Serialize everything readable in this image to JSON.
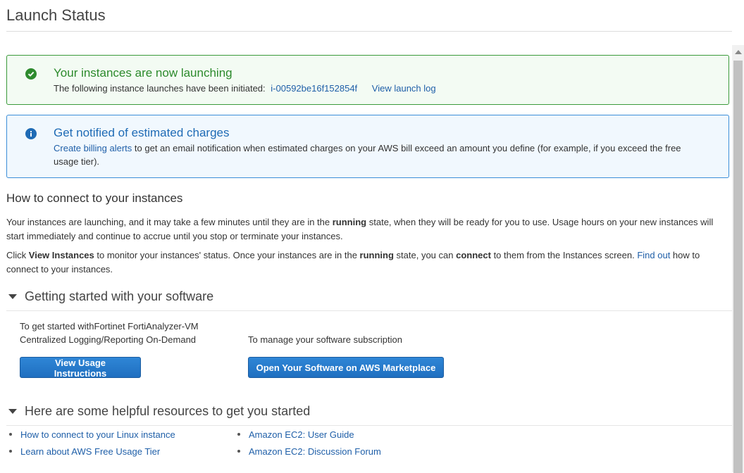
{
  "page": {
    "title": "Launch Status"
  },
  "success_alert": {
    "title": "Your instances are now launching",
    "text": "The following instance launches have been initiated:",
    "instance_id": "i-00592be16f152854f",
    "log_link": "View launch log"
  },
  "info_alert": {
    "title": "Get notified of estimated charges",
    "link": "Create billing alerts",
    "text": "to get an email notification when estimated charges on your AWS bill exceed an amount you define (for example, if you exceed the free usage tier)."
  },
  "connect": {
    "heading": "How to connect to your instances",
    "p1_a": "Your instances are launching, and it may take a few minutes until they are in the ",
    "p1_b": "running",
    "p1_c": " state, when they will be ready for you to use. Usage hours on your new instances will start immediately and continue to accrue until you stop or terminate your instances.",
    "p2_a": "Click ",
    "p2_b": "View Instances",
    "p2_c": " to monitor your instances' status. Once your instances are in the ",
    "p2_d": "running",
    "p2_e": " state, you can ",
    "p2_f": "connect",
    "p2_g": " to them from the Instances screen. ",
    "p2_link": "Find out",
    "p2_h": " how to connect to your instances."
  },
  "software": {
    "heading": "Getting started with your software",
    "left_line1": "To get started withFortinet FortiAnalyzer-VM",
    "left_line2": "Centralized Logging/Reporting On-Demand",
    "left_button": "View Usage Instructions",
    "right_text": "To manage your software subscription",
    "right_button": "Open Your Software on AWS Marketplace"
  },
  "resources": {
    "heading": "Here are some helpful resources to get you started",
    "left_links": [
      "How to connect to your Linux instance",
      "Learn about AWS Free Usage Tier"
    ],
    "right_links": [
      "Amazon EC2: User Guide",
      "Amazon EC2: Discussion Forum"
    ]
  },
  "icons": {
    "success": "check-circle-icon",
    "info": "info-circle-icon",
    "caret": "caret-down-icon"
  }
}
